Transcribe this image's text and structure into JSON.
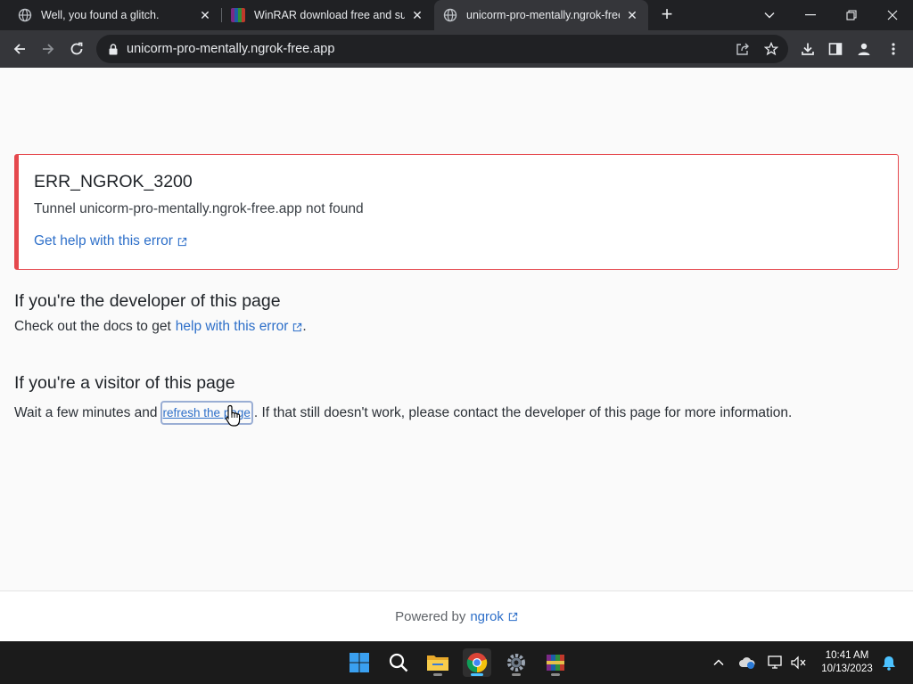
{
  "browser": {
    "tabs": [
      {
        "title": "Well, you found a glitch.",
        "icon": "globe-icon"
      },
      {
        "title": "WinRAR download free and support",
        "icon": "winrar-icon"
      },
      {
        "title": "unicorm-pro-mentally.ngrok-free.app",
        "icon": "globe-icon"
      }
    ],
    "address": "unicorm-pro-mentally.ngrok-free.app",
    "accent": "#35363a"
  },
  "page": {
    "error": {
      "code": "ERR_NGROK_3200",
      "message": "Tunnel unicorm-pro-mentally.ngrok-free.app not found",
      "help_link": "Get help with this error"
    },
    "developer": {
      "heading": "If you're the developer of this page",
      "text_before": "Check out the docs to get",
      "link": "help with this error",
      "text_after": "."
    },
    "visitor": {
      "heading": "If you're a visitor of this page",
      "text_before": "Wait a few minutes and",
      "link": "refresh the page",
      "text_after": ". If that still doesn't work, please contact the developer of this page for more information."
    },
    "footer": {
      "prefix": "Powered by",
      "link": "ngrok"
    },
    "colors": {
      "error_border": "#e5484d",
      "link": "#2d6fc9"
    }
  },
  "taskbar": {
    "apps": [
      "start-icon",
      "search-icon",
      "file-explorer-icon",
      "chrome-icon",
      "settings-icon",
      "winrar-icon"
    ],
    "time": "10:41 AM",
    "date": "10/13/2023"
  }
}
